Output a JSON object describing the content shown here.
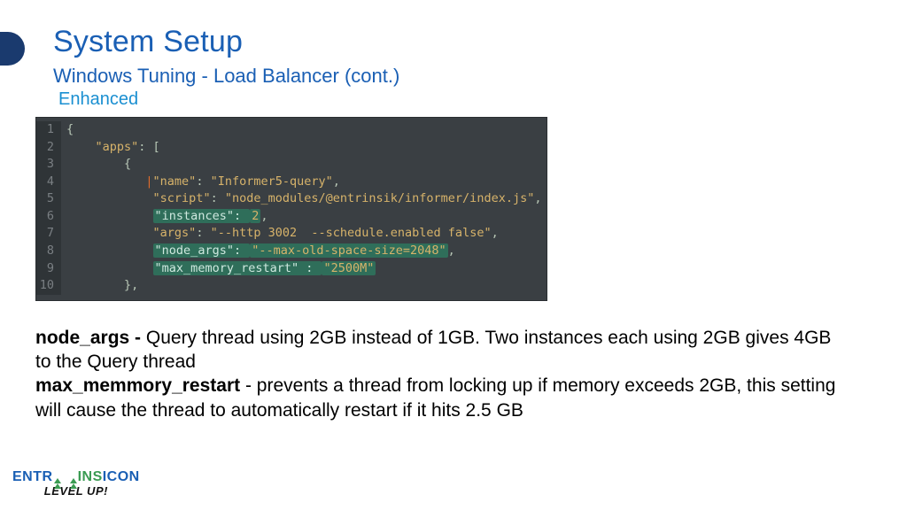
{
  "header": {
    "title": "System Setup",
    "subtitle": "Windows Tuning  -  Load Balancer (cont.)",
    "tag": "Enhanced"
  },
  "code": {
    "lines": [
      {
        "n": "1",
        "indent": 0,
        "plain": "{"
      },
      {
        "n": "2",
        "indent": 4,
        "key": "\"apps\"",
        "after": ": ["
      },
      {
        "n": "3",
        "indent": 8,
        "plain": "{"
      },
      {
        "n": "4",
        "indent": 12,
        "cursor": true,
        "key": "\"name\"",
        "after": ": ",
        "val": "\"Informer5-query\"",
        "tail": ","
      },
      {
        "n": "5",
        "indent": 12,
        "key": "\"script\"",
        "after": ": ",
        "val": "\"node_modules/@entrinsik/informer/index.js\"",
        "tail": ","
      },
      {
        "n": "6",
        "indent": 12,
        "hl_key": "\"instances\": ",
        "hl_val": "2",
        "tail": ","
      },
      {
        "n": "7",
        "indent": 12,
        "key": "\"args\"",
        "after": ": ",
        "val": "\"--http 3002  --schedule.enabled false\"",
        "tail": ","
      },
      {
        "n": "8",
        "indent": 12,
        "hl_key": "\"node_args\": ",
        "hl_val": "\"--max-old-space-size=2048\"",
        "tail": ","
      },
      {
        "n": "9",
        "indent": 12,
        "hl_key": "\"max_memory_restart\" : ",
        "hl_val": "\"2500M\""
      },
      {
        "n": "10",
        "indent": 8,
        "plain": "},"
      }
    ]
  },
  "body": {
    "k1": "node_args - ",
    "p1": " Query thread using 2GB instead of 1GB. Two instances each using 2GB gives 4GB to the Query thread",
    "k2": "max_memmory_restart",
    "p2": " - prevents a thread from locking up if memory exceeds 2GB, this setting will cause the thread to automatically restart if it hits 2.5 GB"
  },
  "logo": {
    "part1": "ENTR",
    "part2": "INS",
    "part3": "ICON",
    "sub": "LEVEL UP!"
  }
}
